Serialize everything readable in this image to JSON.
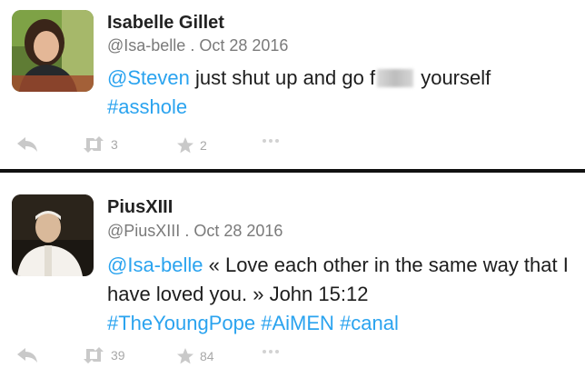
{
  "tweets": [
    {
      "name": "Isabelle Gillet",
      "handle": "@Isa-belle",
      "date": ". Oct 28 2016",
      "mention": "@Steven",
      "text_a": " just shut up and go f",
      "text_b": " yourself",
      "hashtag": "#asshole",
      "retweets": "3",
      "favorites": "2"
    },
    {
      "name": "PiusXIII",
      "handle": "@PiusXIII",
      "date": ". Oct 28 2016",
      "mention": "@Isa-belle",
      "text_a": " « Love each other in the same way that I have loved you. » John 15:12",
      "hashtags": [
        "#TheYoungPope",
        "#AiMEN",
        "#canal"
      ],
      "retweets": "39",
      "favorites": "84"
    }
  ],
  "colors": {
    "link": "#2aa3ef",
    "divider": "#111111",
    "icon": "#c9c9c9"
  },
  "icons": [
    "reply-icon",
    "retweet-icon",
    "star-icon",
    "more-icon"
  ]
}
